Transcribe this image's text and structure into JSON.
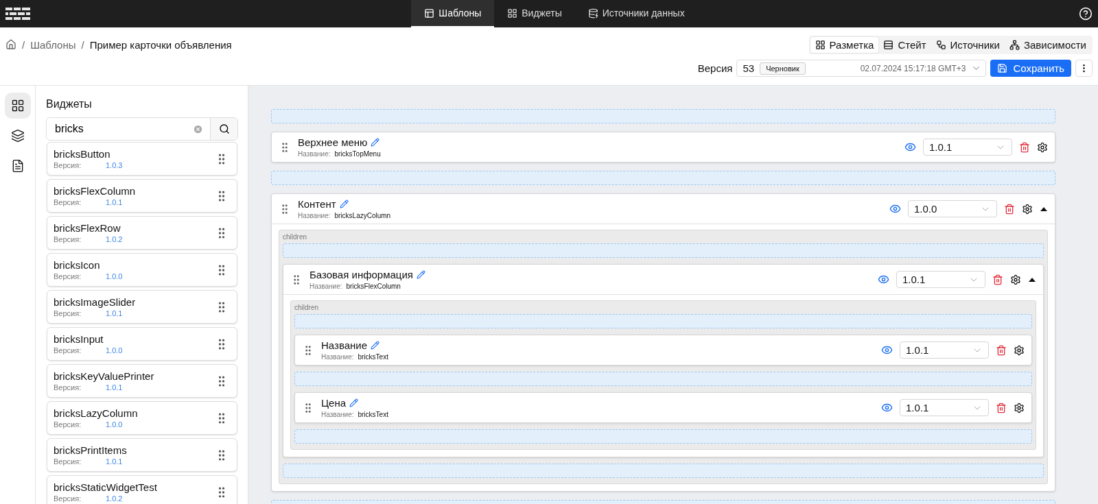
{
  "top_nav": {
    "tabs": [
      {
        "label": "Шаблоны",
        "kind": "templates",
        "selected": true
      },
      {
        "label": "Виджеты",
        "kind": "widgets",
        "selected": false
      },
      {
        "label": "Источники данных",
        "kind": "sources",
        "selected": false
      }
    ]
  },
  "breadcrumbs": [
    {
      "separator": "/",
      "label": "Шаблоны"
    },
    {
      "separator": "/",
      "label": "Пример карточки объявления"
    }
  ],
  "view_tabs": [
    {
      "label": "Разметка",
      "kind": "layout",
      "selected": true
    },
    {
      "label": "Стейт",
      "kind": "state",
      "selected": false
    },
    {
      "label": "Источники",
      "kind": "sources",
      "selected": false
    },
    {
      "label": "Зависимости",
      "kind": "deps",
      "selected": false
    }
  ],
  "version_bar": {
    "label": "Версия",
    "number": "53",
    "status": "Черновик",
    "date": "02.07.2024 15:17:18 GMT+3",
    "save_button": "Сохранить"
  },
  "rail": [
    {
      "kind": "widgets",
      "selected": true
    },
    {
      "kind": "layers",
      "selected": false
    },
    {
      "kind": "document",
      "selected": false
    }
  ],
  "widgets_panel": {
    "title": "Виджеты",
    "search": {
      "value": "bricks"
    },
    "items": [
      {
        "name": "bricksButton",
        "version_label": "Версия:",
        "version": "1.0.3"
      },
      {
        "name": "bricksFlexColumn",
        "version_label": "Версия:",
        "version": "1.0.1"
      },
      {
        "name": "bricksFlexRow",
        "version_label": "Версия:",
        "version": "1.0.2"
      },
      {
        "name": "bricksIcon",
        "version_label": "Версия:",
        "version": "1.0.0"
      },
      {
        "name": "bricksImageSlider",
        "version_label": "Версия:",
        "version": "1.0.1"
      },
      {
        "name": "bricksInput",
        "version_label": "Версия:",
        "version": "1.0.0"
      },
      {
        "name": "bricksKeyValuePrinter",
        "version_label": "Версия:",
        "version": "1.0.1"
      },
      {
        "name": "bricksLazyColumn",
        "version_label": "Версия:",
        "version": "1.0.0"
      },
      {
        "name": "bricksPrintItems",
        "version_label": "Версия:",
        "version": "1.0.1"
      },
      {
        "name": "bricksStaticWidgetTest",
        "version_label": "Версия:",
        "version": "1.0.2"
      }
    ]
  },
  "canvas": {
    "nodes": [
      {
        "title": "Верхнее меню",
        "name_label": "Название:",
        "name": "bricksTopMenu",
        "version": "1.0.1"
      },
      {
        "title": "Контент",
        "name_label": "Название:",
        "name": "bricksLazyColumn",
        "version": "1.0.0",
        "expanded": true,
        "children_label": "children",
        "children": [
          {
            "title": "Базовая информация",
            "name_label": "Название:",
            "name": "bricksFlexColumn",
            "version": "1.0.1",
            "expanded": true,
            "children_label": "children",
            "children": [
              {
                "title": "Название",
                "name_label": "Название:",
                "name": "bricksText",
                "version": "1.0.1"
              },
              {
                "title": "Цена",
                "name_label": "Название:",
                "name": "bricksText",
                "version": "1.0.1"
              }
            ]
          }
        ]
      }
    ]
  }
}
